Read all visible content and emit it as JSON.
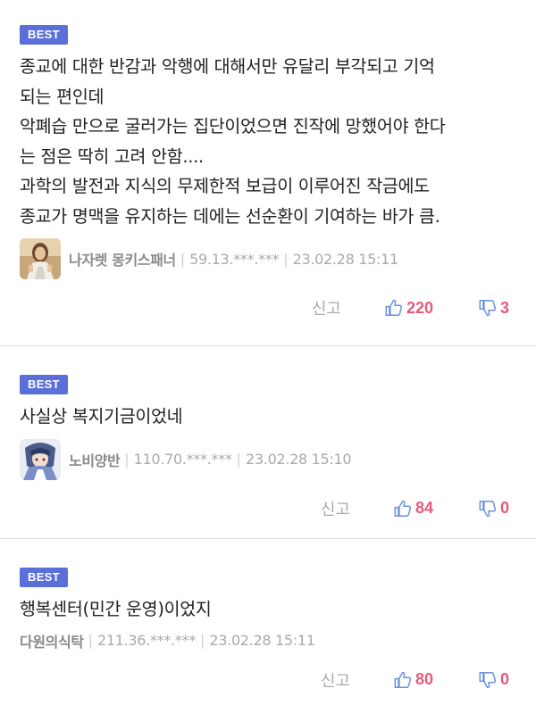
{
  "comments": [
    {
      "badge": "BEST",
      "text": "종교에 대한 반감과 악행에 대해서만 유달리 부각되고 기억\n되는 편인데\n악폐습 만으로 굴러가는 집단이었으면 진작에 망했어야 한다\n는 점은 딱히 고려 안함....\n과학의 발전과 지식의 무제한적 보급이 이루어진 작금에도\n종교가 명맥을 유지하는 데에는 선순환이 기여하는 바가 큼.",
      "nickname": "나자렛 몽키스패너",
      "ip": "59.13.***.***",
      "date": "23.02.28 15:11",
      "report": "신고",
      "upvotes": "220",
      "downvotes": "3",
      "avatar_icon": "jesus-portrait-avatar"
    },
    {
      "badge": "BEST",
      "text": "사실상 복지기금이었네",
      "nickname": "노비양반",
      "ip": "110.70.***.***",
      "date": "23.02.28 15:10",
      "report": "신고",
      "upvotes": "84",
      "downvotes": "0",
      "avatar_icon": "anime-character-avatar"
    },
    {
      "badge": "BEST",
      "text": "행복센터(민간 운영)이었지",
      "nickname": "다원의식탁",
      "ip": "211.36.***.***",
      "date": "23.02.28 15:11",
      "report": "신고",
      "upvotes": "80",
      "downvotes": "0"
    }
  ],
  "colors": {
    "badge": "#5b6fd8",
    "vote_count": "#e45b7a",
    "thumb_icon": "#6b8fe0",
    "meta_text": "#a9a9a9"
  },
  "separator": "|"
}
